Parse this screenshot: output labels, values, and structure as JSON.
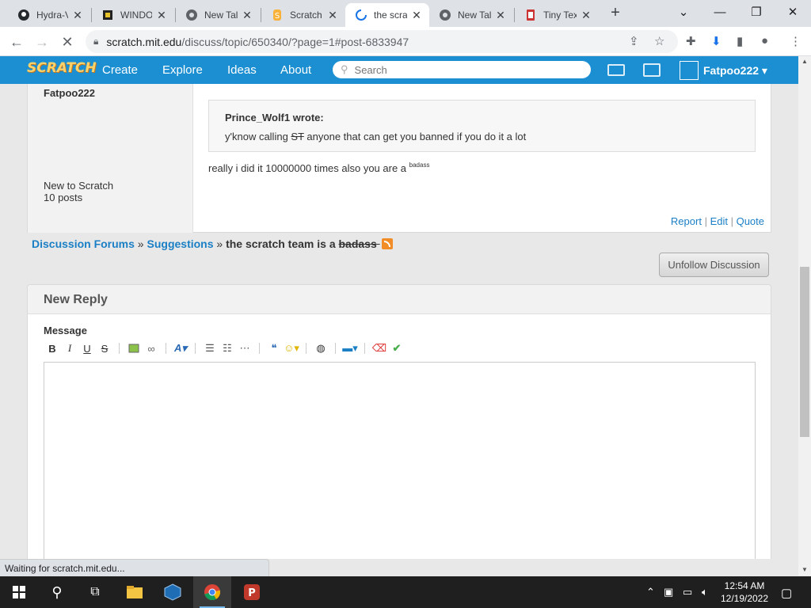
{
  "browser": {
    "tabs": [
      {
        "title": "Hydra-V",
        "icon": "github-icon"
      },
      {
        "title": "WINDO",
        "icon": "film-icon"
      },
      {
        "title": "New Tal",
        "icon": "chrome-icon"
      },
      {
        "title": "Scratch",
        "icon": "scratch-icon"
      },
      {
        "title": "the scra",
        "icon": "loading-icon",
        "active": true
      },
      {
        "title": "New Tal",
        "icon": "chrome-icon"
      },
      {
        "title": "Tiny Tex",
        "icon": "tinytex-icon"
      }
    ],
    "url_host": "scratch.mit.edu",
    "url_path": "/discuss/topic/650340/?page=1#post-6833947",
    "status_text": "Waiting for scratch.mit.edu..."
  },
  "header": {
    "logo": "SCRATCH",
    "nav": [
      "Create",
      "Explore",
      "Ideas",
      "About"
    ],
    "search_placeholder": "Search",
    "username": "Fatpoo222"
  },
  "post": {
    "author": "Fatpoo222",
    "rank": "New to Scratch",
    "post_count": "10 posts",
    "quote_author": "Prince_Wolf1 wrote:",
    "quote_before": "y'know calling ",
    "quote_strike": "ST",
    "quote_after": " anyone that can get you banned if you do it a lot",
    "body_text": "really i did it 10000000 times also you are a ",
    "body_sup": "badass",
    "actions": [
      "Report",
      "Edit",
      "Quote"
    ]
  },
  "breadcrumb": {
    "forums": "Discussion Forums",
    "category": "Suggestions",
    "topic_before": "the scratch team is a ",
    "topic_strike": "badass "
  },
  "unfollow_label": "Unfollow Discussion",
  "reply": {
    "title": "New Reply",
    "message_label": "Message"
  },
  "taskbar": {
    "time": "12:54 AM",
    "date": "12/19/2022"
  }
}
